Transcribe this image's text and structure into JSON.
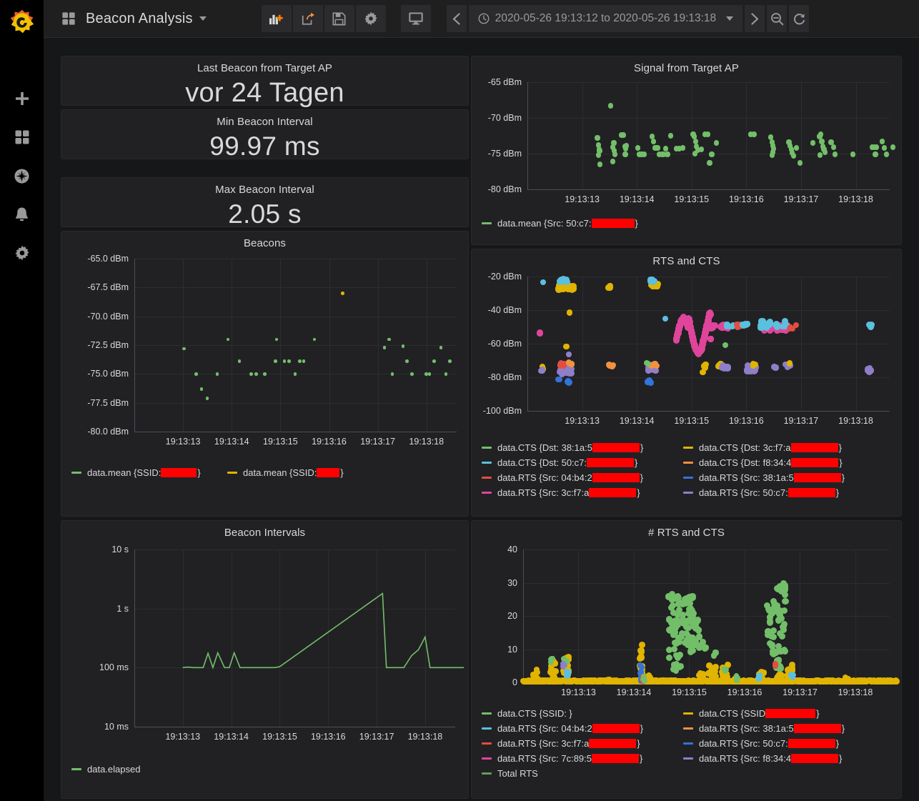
{
  "sidebar": {
    "logo": "grafana-logo",
    "items": [
      {
        "name": "create-add",
        "icon": "plus-icon"
      },
      {
        "name": "dashboards",
        "icon": "dashboards-icon"
      },
      {
        "name": "explore",
        "icon": "compass-icon"
      },
      {
        "name": "alerting",
        "icon": "bell-icon"
      },
      {
        "name": "configuration",
        "icon": "gear-icon"
      }
    ]
  },
  "topbar": {
    "dashboard_icon": "dashboards-icon",
    "title": "Beacon Analysis",
    "tools": [
      {
        "name": "add-panel",
        "icon": "add-panel-icon"
      },
      {
        "name": "share-dashboard",
        "icon": "share-icon"
      },
      {
        "name": "save-dashboard",
        "icon": "save-icon"
      },
      {
        "name": "dashboard-settings",
        "icon": "gear-icon"
      },
      {
        "name": "cycle-view-mode",
        "icon": "tv-icon"
      }
    ],
    "time": {
      "prev_icon": "chevron-left-icon",
      "clock_icon": "clock-icon",
      "range": "2020-05-26 19:13:12 to 2020-05-26 19:13:18",
      "next_icon": "chevron-right-icon",
      "zoom_out_icon": "zoom-out-icon",
      "refresh_icon": "refresh-icon"
    }
  },
  "colors": {
    "green": "#73BF69",
    "dark_green": "#629E56",
    "yellow": "#E0B400",
    "cyan": "#5BC0DE",
    "orange": "#F2913F",
    "red": "#E24D42",
    "blue": "#3274D9",
    "magenta": "#E0459B",
    "purple": "#8F7EC8",
    "redaction": "#FF0000",
    "panel_bg": "#212124",
    "page_bg": "#161719",
    "grid": "#2c2d30",
    "text": "#d8d9da"
  },
  "panels": {
    "last_beacon": {
      "title": "Last Beacon from Target AP",
      "value": "vor 24 Tagen"
    },
    "min_interval": {
      "title": "Min Beacon Interval",
      "value": "99.97 ms"
    },
    "max_interval": {
      "title": "Max Beacon Interval",
      "value": "2.05 s"
    },
    "signal": {
      "title": "Signal from Target AP"
    },
    "beacons": {
      "title": "Beacons"
    },
    "rts_cts": {
      "title": "RTS and CTS"
    },
    "beacon_intervals": {
      "title": "Beacon Intervals"
    },
    "num_rts_cts": {
      "title": "# RTS and CTS"
    }
  },
  "chart_data": [
    {
      "id": "signal",
      "type": "scatter",
      "title": "Signal from Target AP",
      "xlabel": "",
      "ylabel": "",
      "grid": true,
      "legend_position": "bottom",
      "ylim": [
        -80,
        -65
      ],
      "yticks": [
        "-65 dBm",
        "-70 dBm",
        "-75 dBm",
        "-80 dBm"
      ],
      "ytick_values": [
        -65,
        -70,
        -75,
        -80
      ],
      "xticks": [
        "19:13:13",
        "19:13:14",
        "19:13:15",
        "19:13:16",
        "19:13:17",
        "19:13:18"
      ],
      "xlim": [
        "19:13:12",
        "19:13:18.6"
      ],
      "series": [
        {
          "name": "data.mean {Src: 50:c7:",
          "redacted": true,
          "redact_width": 60,
          "suffix": "}",
          "color": "#73BF69",
          "points": [
            [
              0.28,
              -72.8
            ],
            [
              0.3,
              -73.8
            ],
            [
              0.31,
              -74.4
            ],
            [
              0.32,
              -74.6
            ],
            [
              0.3,
              -75.2
            ],
            [
              0.33,
              -76.5
            ],
            [
              0.52,
              -68.3
            ],
            [
              0.56,
              -74.1
            ],
            [
              0.58,
              -73.5
            ],
            [
              0.59,
              -74.6
            ],
            [
              0.6,
              -75.1
            ],
            [
              0.56,
              -76.1
            ],
            [
              0.72,
              -72.4
            ],
            [
              0.75,
              -72.4
            ],
            [
              0.78,
              -74.0
            ],
            [
              0.8,
              -74.3
            ],
            [
              0.79,
              -75.1
            ],
            [
              0.81,
              -73.9
            ],
            [
              1.02,
              -74.2
            ],
            [
              1.05,
              -75.1
            ],
            [
              1.09,
              -75.1
            ],
            [
              1.13,
              -75.1
            ],
            [
              1.28,
              -72.6
            ],
            [
              1.3,
              -73.3
            ],
            [
              1.33,
              -74.2
            ],
            [
              1.36,
              -74.2
            ],
            [
              1.38,
              -74.2
            ],
            [
              1.41,
              -75.1
            ],
            [
              1.46,
              -75.1
            ],
            [
              1.49,
              -75.1
            ],
            [
              1.53,
              -74.3
            ],
            [
              1.56,
              -75.1
            ],
            [
              1.62,
              -72.5
            ],
            [
              1.72,
              -74.3
            ],
            [
              1.78,
              -74.3
            ],
            [
              1.84,
              -74.2
            ],
            [
              2.03,
              -72.3
            ],
            [
              2.05,
              -72.6
            ],
            [
              2.07,
              -73.3
            ],
            [
              2.09,
              -74.0
            ],
            [
              2.11,
              -74.5
            ],
            [
              2.06,
              -75.0
            ],
            [
              2.18,
              -74.4
            ],
            [
              2.25,
              -72.3
            ],
            [
              2.3,
              -72.3
            ],
            [
              2.37,
              -75.1
            ],
            [
              2.33,
              -76.3
            ],
            [
              2.45,
              -73.5
            ],
            [
              3.08,
              -72.3
            ],
            [
              3.14,
              -72.3
            ],
            [
              3.45,
              -72.7
            ],
            [
              3.47,
              -73.4
            ],
            [
              3.49,
              -73.9
            ],
            [
              3.5,
              -74.3
            ],
            [
              3.48,
              -74.8
            ],
            [
              3.47,
              -75.2
            ],
            [
              3.78,
              -73.4
            ],
            [
              3.8,
              -73.9
            ],
            [
              3.82,
              -74.4
            ],
            [
              3.84,
              -74.9
            ],
            [
              3.86,
              -75.3
            ],
            [
              3.92,
              -74.2
            ],
            [
              3.98,
              -76.3
            ],
            [
              4.22,
              -73.5
            ],
            [
              4.34,
              -72.6
            ],
            [
              4.36,
              -72.3
            ],
            [
              4.38,
              -73.3
            ],
            [
              4.4,
              -74.0
            ],
            [
              4.42,
              -74.4
            ],
            [
              4.44,
              -74.8
            ],
            [
              4.35,
              -75.2
            ],
            [
              4.55,
              -73.4
            ],
            [
              4.6,
              -74.1
            ],
            [
              4.62,
              -75.1
            ],
            [
              4.95,
              -75.1
            ],
            [
              5.3,
              -74.1
            ],
            [
              5.34,
              -74.1
            ],
            [
              5.38,
              -74.1
            ],
            [
              5.36,
              -75.1
            ],
            [
              5.48,
              -73.3
            ],
            [
              5.52,
              -74.2
            ],
            [
              5.56,
              -75.1
            ],
            [
              5.68,
              -74.1
            ]
          ]
        }
      ]
    },
    {
      "id": "beacons",
      "type": "scatter",
      "title": "Beacons",
      "grid": true,
      "legend_position": "bottom",
      "ylim": [
        -80,
        -65
      ],
      "yticks": [
        "-65.0 dBm",
        "-67.5 dBm",
        "-70.0 dBm",
        "-72.5 dBm",
        "-75.0 dBm",
        "-77.5 dBm",
        "-80.0 dBm"
      ],
      "ytick_values": [
        -65,
        -67.5,
        -70,
        -72.5,
        -75,
        -77.5,
        -80
      ],
      "xticks": [
        "19:13:13",
        "19:13:14",
        "19:13:15",
        "19:13:16",
        "19:13:17",
        "19:13:18"
      ],
      "series": [
        {
          "name": "data.mean {SSID: ",
          "redacted": true,
          "redact_width": 50,
          "suffix": "}",
          "color": "#73BF69",
          "points": [
            [
              0.02,
              -72.8
            ],
            [
              0.27,
              -75.0
            ],
            [
              0.38,
              -76.3
            ],
            [
              0.5,
              -77.1
            ],
            [
              0.7,
              -75.0
            ],
            [
              0.92,
              -72.0
            ],
            [
              1.16,
              -73.9
            ],
            [
              1.4,
              -75.0
            ],
            [
              1.5,
              -75.0
            ],
            [
              1.68,
              -75.0
            ],
            [
              1.92,
              -72.0
            ],
            [
              1.9,
              -73.9
            ],
            [
              2.08,
              -73.9
            ],
            [
              2.18,
              -73.9
            ],
            [
              2.4,
              -73.9
            ],
            [
              2.48,
              -73.9
            ],
            [
              2.3,
              -75.0
            ],
            [
              2.7,
              -72.0
            ],
            [
              4.14,
              -72.7
            ],
            [
              4.23,
              -72.0
            ],
            [
              4.3,
              -75.0
            ],
            [
              4.52,
              -72.6
            ],
            [
              4.6,
              -73.9
            ],
            [
              4.7,
              -75.0
            ],
            [
              5.0,
              -75.0
            ],
            [
              5.06,
              -75.0
            ],
            [
              5.16,
              -73.9
            ],
            [
              5.3,
              -72.7
            ],
            [
              5.4,
              -75.0
            ],
            [
              5.48,
              -73.9
            ]
          ]
        },
        {
          "name": "data.mean {SSID: ",
          "redacted": true,
          "redact_width": 32,
          "suffix": "}",
          "color": "#E0B400",
          "points": [
            [
              3.28,
              -68.0
            ]
          ]
        }
      ]
    },
    {
      "id": "rts_cts",
      "type": "scatter",
      "title": "RTS and CTS",
      "grid": true,
      "legend_position": "bottom",
      "ylim": [
        -100,
        -20
      ],
      "yticks": [
        "-20 dBm",
        "-40 dBm",
        "-60 dBm",
        "-80 dBm",
        "-100 dBm"
      ],
      "ytick_values": [
        -20,
        -40,
        -60,
        -80,
        -100
      ],
      "xticks": [
        "19:13:13",
        "19:13:14",
        "19:13:15",
        "19:13:16",
        "19:13:17",
        "19:13:18"
      ],
      "legend_entries": [
        {
          "name": "data.CTS {Dst: 38:1a:5",
          "color": "#73BF69",
          "redact_width": 66,
          "suffix": "}"
        },
        {
          "name": "data.CTS {Dst: 3c:f7:a",
          "color": "#E0B400",
          "redact_width": 66,
          "suffix": "}"
        },
        {
          "name": "data.CTS {Dst: 50:c7:",
          "color": "#5BC0DE",
          "redact_width": 66,
          "suffix": "}"
        },
        {
          "name": "data.CTS {Dst: f8:34:4",
          "color": "#F2913F",
          "redact_width": 66,
          "suffix": "}"
        },
        {
          "name": "data.RTS {Src: 04:b4:2",
          "color": "#E24D42",
          "redact_width": 66,
          "suffix": "}"
        },
        {
          "name": "data.RTS {Src: 38:1a:5",
          "color": "#3274D9",
          "redact_width": 66,
          "suffix": "}"
        },
        {
          "name": "data.RTS {Src: 3c:f7:a",
          "color": "#E0459B",
          "redact_width": 66,
          "suffix": "}"
        },
        {
          "name": "data.RTS {Src: 50:c7:",
          "color": "#8F7EC8",
          "redact_width": 66,
          "suffix": "}"
        }
      ]
    },
    {
      "id": "beacon_intervals",
      "type": "line",
      "title": "Beacon Intervals",
      "grid": true,
      "yscale": "log",
      "legend_position": "bottom",
      "yticks": [
        "10 s",
        "1 s",
        "100 ms",
        "10 ms"
      ],
      "ytick_values": [
        10000,
        1000,
        100,
        10
      ],
      "xticks": [
        "19:13:13",
        "19:13:14",
        "19:13:15",
        "19:13:16",
        "19:13:17",
        "19:13:18"
      ],
      "series": [
        {
          "name": "data.elapsed",
          "color": "#73BF69",
          "points": [
            [
              0.0,
              100
            ],
            [
              0.1,
              102
            ],
            [
              0.22,
              100
            ],
            [
              0.3,
              100
            ],
            [
              0.42,
              100
            ],
            [
              0.52,
              175
            ],
            [
              0.62,
              100
            ],
            [
              0.72,
              178
            ],
            [
              0.86,
              100
            ],
            [
              0.96,
              100
            ],
            [
              1.06,
              178
            ],
            [
              1.18,
              100
            ],
            [
              1.4,
              100
            ],
            [
              1.9,
              100
            ],
            [
              2.0,
              104
            ],
            [
              4.12,
              1800
            ],
            [
              4.2,
              100
            ],
            [
              4.44,
              100
            ],
            [
              4.56,
              100
            ],
            [
              4.72,
              160
            ],
            [
              4.86,
              200
            ],
            [
              5.0,
              330
            ],
            [
              5.1,
              100
            ],
            [
              5.4,
              100
            ],
            [
              5.8,
              100
            ]
          ]
        }
      ]
    },
    {
      "id": "num_rts_cts",
      "type": "scatter",
      "title": "# RTS and CTS",
      "grid": true,
      "legend_position": "bottom",
      "ylim": [
        0,
        40
      ],
      "yticks": [
        "40",
        "30",
        "20",
        "10",
        "0"
      ],
      "ytick_values": [
        40,
        30,
        20,
        10,
        0
      ],
      "xticks": [
        "19:13:13",
        "19:13:14",
        "19:13:15",
        "19:13:16",
        "19:13:17",
        "19:13:18"
      ],
      "legend_entries": [
        {
          "name": "data.CTS {SSID: }",
          "color": "#73BF69",
          "redact_width": 0,
          "suffix": ""
        },
        {
          "name": "data.CTS {SSID",
          "color": "#E0B400",
          "redact_width": 70,
          "suffix": "}"
        },
        {
          "name": "data.RTS {Src: 04:b4:2",
          "color": "#5BC0DE",
          "redact_width": 66,
          "suffix": "}"
        },
        {
          "name": "data.RTS {Src: 38:1a:5",
          "color": "#F2913F",
          "redact_width": 66,
          "suffix": "}"
        },
        {
          "name": "data.RTS {Src: 3c:f7:a",
          "color": "#E24D42",
          "redact_width": 66,
          "suffix": "}"
        },
        {
          "name": "data.RTS {Src: 50:c7:",
          "color": "#3274D9",
          "redact_width": 66,
          "suffix": "}"
        },
        {
          "name": "data.RTS {Src: 7c:89:5",
          "color": "#E0459B",
          "redact_width": 66,
          "suffix": "}"
        },
        {
          "name": "data.RTS {Src: f8:34:4",
          "color": "#8F7EC8",
          "redact_width": 66,
          "suffix": "}"
        },
        {
          "name": "Total RTS",
          "color": "#629E56",
          "redact_width": 0,
          "suffix": ""
        }
      ]
    }
  ]
}
